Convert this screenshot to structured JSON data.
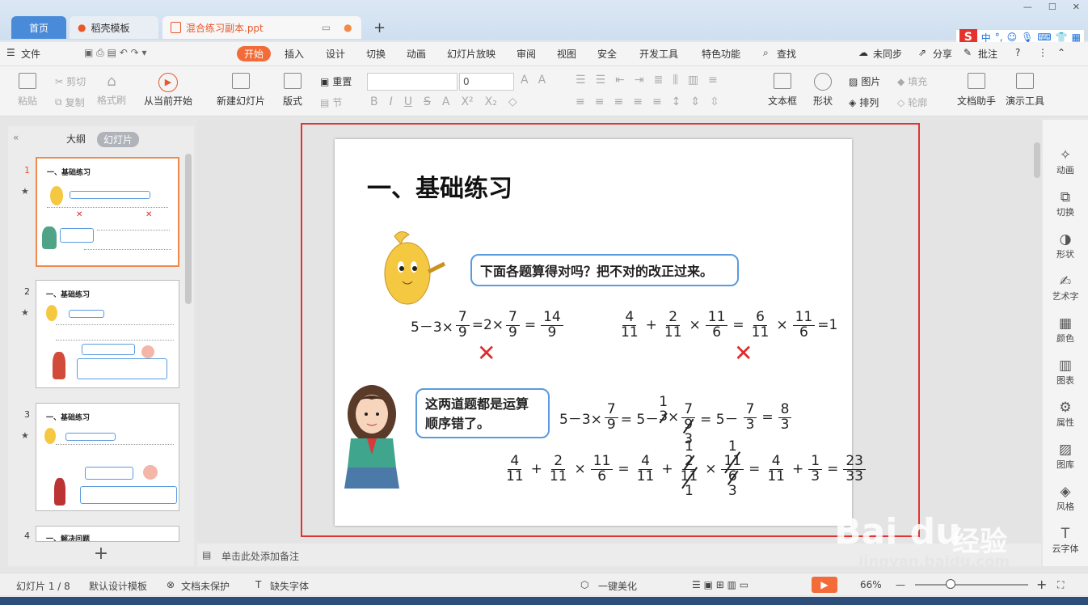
{
  "tabs": {
    "home": "首页",
    "template": "稻壳模板",
    "active": "混合练习副本.ppt"
  },
  "menubar": {
    "file": "文件",
    "start": "开始",
    "items": [
      "插入",
      "设计",
      "切换",
      "动画",
      "幻灯片放映",
      "审阅",
      "视图",
      "安全",
      "开发工具",
      "特色功能"
    ],
    "search": "查找",
    "sync": "未同步",
    "share": "分享",
    "comment": "批注"
  },
  "ribbon": {
    "paste": "粘贴",
    "cut": "剪切",
    "copy": "复制",
    "format_painter": "格式刷",
    "from_current": "从当前开始",
    "new_slide": "新建幻灯片",
    "layout": "版式",
    "reset": "重置",
    "section": "节",
    "font_size": "0",
    "textbox": "文本框",
    "shape": "形状",
    "picture": "图片",
    "arrange": "排列",
    "fill": "填充",
    "outline": "轮廓",
    "doc_helper": "文档助手",
    "presenter": "演示工具"
  },
  "ime": {
    "logo": "S",
    "lang": "中"
  },
  "panel": {
    "outline_tab": "大纲",
    "slides_tab": "幻灯片",
    "thumb_title": "一、基础练习",
    "thumb4_title": "一、解决问题",
    "nums": [
      "1",
      "2",
      "3",
      "4"
    ]
  },
  "slide": {
    "title": "一、基础练习",
    "bubble1": "下面各题算得对吗？把不对的改正过来。",
    "bubble2_l1": "这两道题都是运算",
    "bubble2_l2": "顺序错了。",
    "wrong_mark": "✕",
    "eq1": {
      "a": "5－3×",
      "f1n": "7",
      "f1d": "9",
      "b": "=2×",
      "f2n": "7",
      "f2d": "9",
      "c": "=",
      "f3n": "14",
      "f3d": "9"
    },
    "eq2": {
      "f1n": "4",
      "f1d": "11",
      "op1": "+",
      "f2n": "2",
      "f2d": "11",
      "op2": "×",
      "f3n": "11",
      "f3d": "6",
      "eq": "=",
      "f4n": "6",
      "f4d": "11",
      "op3": "×",
      "f5n": "11",
      "f5d": "6",
      "tail": "=1"
    },
    "eq3": {
      "a": "5－3×",
      "f1n": "7",
      "f1d": "9",
      "b": "= 5－",
      "s1": "3",
      "s1top": "1",
      "op": "×",
      "f2n": "7",
      "f2d": "9",
      "f2bot": "3",
      "c": "= 5－",
      "f3n": "7",
      "f3d": "3",
      "d": "=",
      "f4n": "8",
      "f4d": "3"
    },
    "eq4": {
      "f1n": "4",
      "f1d": "11",
      "op1": "+",
      "f2n": "2",
      "f2d": "11",
      "op2": "×",
      "f3n": "11",
      "f3d": "6",
      "eq": "=",
      "f4n": "4",
      "f4d": "11",
      "op3": "+",
      "f5top": "1",
      "f5n": "2",
      "f5d": "11",
      "f5bot": "1",
      "op4": "×",
      "f6top": "1",
      "f6n": "11",
      "f6d": "6",
      "f6bot": "3",
      "eq2": "=",
      "f7n": "4",
      "f7d": "11",
      "op5": "+",
      "f8n": "1",
      "f8d": "3",
      "eq3": "=",
      "f9n": "23",
      "f9d": "33"
    }
  },
  "right_tools": [
    "动画",
    "切换",
    "形状",
    "艺术字",
    "颜色",
    "图表",
    "属性",
    "图库",
    "风格",
    "云字体"
  ],
  "notes": "单击此处添加备注",
  "status": {
    "slide_count": "幻灯片 1 / 8",
    "design": "默认设计模板",
    "protect": "文档未保护",
    "missing_font": "缺失字体",
    "beautify": "一键美化",
    "zoom": "66%"
  },
  "watermark": {
    "logo": "Bai du",
    "cn": "经验",
    "url": "jingyan.baidu.com"
  }
}
